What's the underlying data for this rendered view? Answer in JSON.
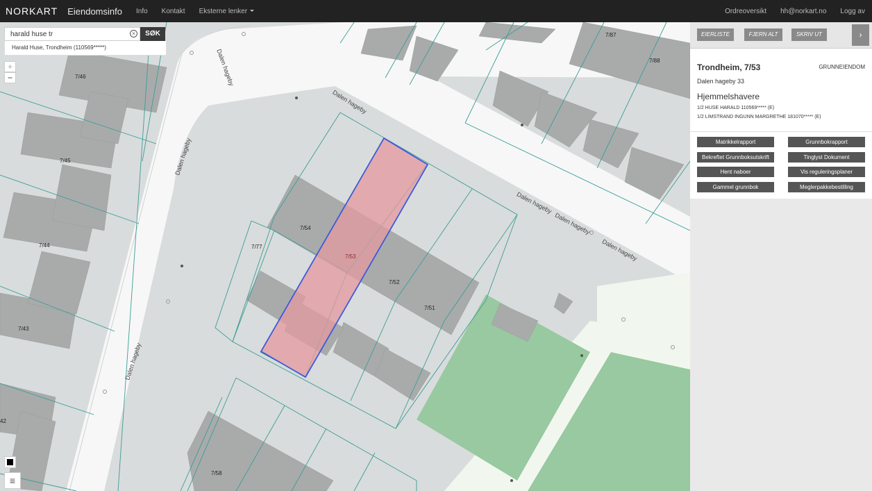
{
  "navbar": {
    "logo": "NORKART",
    "app_title": "Eiendomsinfo",
    "links": [
      "Info",
      "Kontakt",
      "Eksterne lenker"
    ],
    "right_links": [
      "Ordreoversikt",
      "hh@norkart.no",
      "Logg av"
    ]
  },
  "search": {
    "query": "harald huse tr",
    "button": "SØK",
    "result": "Harald Huse, Trondheim (110569*****)"
  },
  "map": {
    "zoom_in": "+",
    "zoom_out": "−",
    "parcels": [
      "7/87",
      "7/88",
      "7/46",
      "7/45",
      "7/44",
      "7/43",
      "42",
      "7/54",
      "7/77",
      "7/53",
      "7/52",
      "7/51",
      "7/58"
    ],
    "roads": [
      "Dalen hageby",
      "Dalen hageby",
      "Dalen hageby",
      "Dalen hageby",
      "Dalen hageby",
      "Dalen hageby",
      "Dalen hageby"
    ],
    "highlight_color": "#e49a9f",
    "green_area_color": "#98c9a0"
  },
  "panel": {
    "buttons": [
      "EIERLISTE",
      "FJERN ALT",
      "SKRIV UT"
    ],
    "expand": "›",
    "title": "Trondheim, 7/53",
    "type": "GRUNNEIENDOM",
    "address": "Dalen hageby 33",
    "owners_heading": "Hjemmelshavere",
    "owners": [
      "1/2 HUSE HARALD 110569***** (E)",
      "1/2 LIMSTRAND INGUNN MARGRETHE 181070***** (E)"
    ],
    "actions": [
      "Matrikkelrapport",
      "Grunnbokrapport",
      "Bekreftet Grunnboksutskrift",
      "Tinglyst Dokument",
      "Hent naboer",
      "Vis reguleringsplaner",
      "Gammel grunnbok",
      "Meglerpakkebestilling"
    ]
  }
}
